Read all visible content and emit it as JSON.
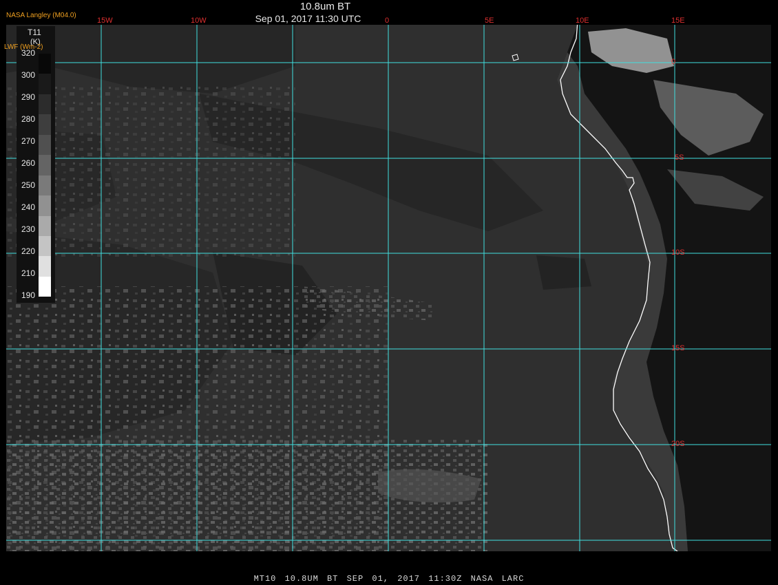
{
  "header": {
    "title": "10.8um BT",
    "subtitle": "Sep 01, 2017 11:30 UTC",
    "org": "NASA Langley (M04.0)",
    "lwf_label": "LWF (Wm-2)"
  },
  "legend": {
    "variable": "T11",
    "unit": "(K)",
    "ticks": [
      "320",
      "300",
      "290",
      "280",
      "270",
      "260",
      "250",
      "240",
      "230",
      "220",
      "210",
      "190"
    ],
    "swatches": [
      "#080808",
      "#1a1a1a",
      "#2c2c2c",
      "#3e3e3e",
      "#505050",
      "#646464",
      "#7a7a7a",
      "#919191",
      "#aaaaaa",
      "#c4c4c4",
      "#e0e0e0",
      "#ffffff"
    ]
  },
  "grid": {
    "lon_labels": [
      "15W",
      "10W",
      "0",
      "5E",
      "10E",
      "15E"
    ],
    "lat_labels": [
      "0",
      "5S",
      "10S",
      "15S",
      "20S"
    ],
    "line_color": "#40e0e0",
    "label_color": "#e03030"
  },
  "footer": {
    "text": "MT10  10.8UM BT   SEP 01, 2017 11:30Z  NASA LARC"
  }
}
